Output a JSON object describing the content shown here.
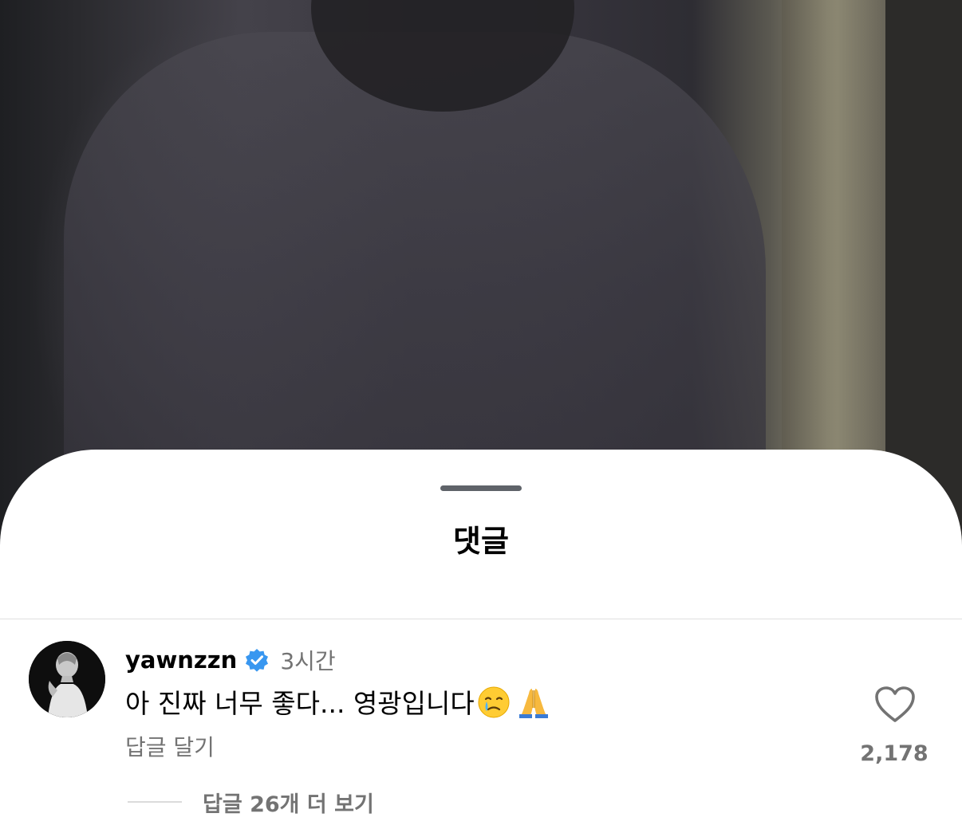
{
  "sheet": {
    "title": "댓글"
  },
  "comment": {
    "username": "yawnzzn",
    "verified_icon": "verified-badge-icon",
    "timestamp": "3시간",
    "text": "아 진짜 너무 좋다... 영광입니다",
    "emojis": [
      "face-holding-back-tears",
      "folded-hands"
    ],
    "reply_label": "답글 달기",
    "like_icon": "heart-outline-icon",
    "like_count": "2,178",
    "view_replies_label": "답글 26개 더 보기"
  },
  "colors": {
    "sheet_bg": "#ffffff",
    "secondary_text": "#737373",
    "verified_blue": "#3897f0",
    "grabber": "#5f6369"
  }
}
